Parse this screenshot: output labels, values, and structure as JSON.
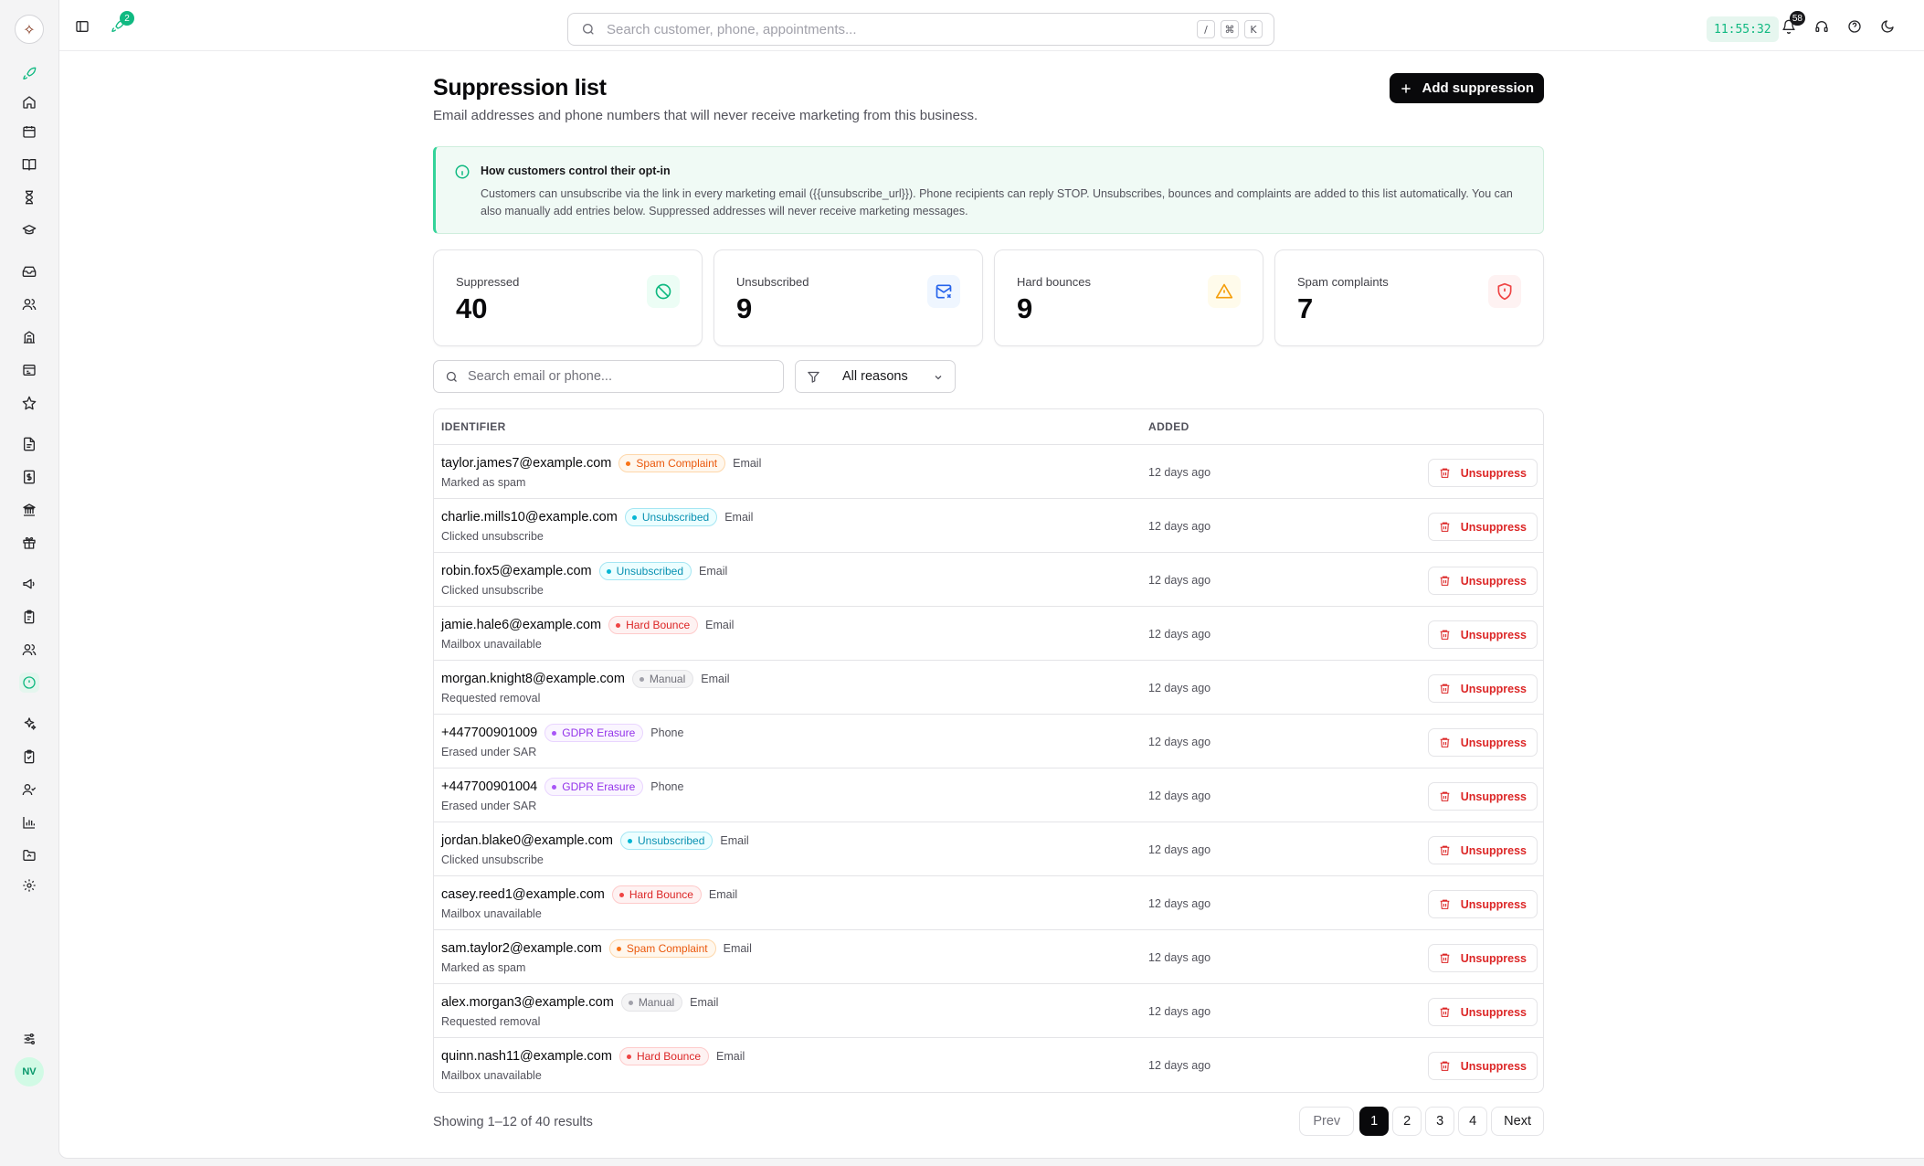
{
  "app": {
    "logo_glyph": "✧"
  },
  "topbar": {
    "rocket_badge": "2",
    "search_placeholder": "Search customer, phone, appointments...",
    "kbd": [
      "/",
      "⌘",
      "K"
    ],
    "clock": "11:55:32",
    "notifications_badge": "58"
  },
  "sidebar": {
    "avatar_initials": "NV",
    "items": [
      "rocket-icon",
      "home-icon",
      "calendar-icon",
      "book-icon",
      "hourglass-icon",
      "graduation-icon",
      "inbox-icon",
      "users-icon",
      "building-icon",
      "receipt-icon",
      "star-icon",
      "document-icon",
      "invoice-icon",
      "bank-icon",
      "gift-icon",
      "megaphone-icon",
      "clipboard-icon",
      "team-icon",
      "suppression-icon",
      "sparkles-icon",
      "checklist-icon",
      "user-check-icon",
      "chart-icon",
      "folder-icon",
      "settings-icon",
      "sliders-icon"
    ]
  },
  "page": {
    "title": "Suppression list",
    "subtitle": "Email addresses and phone numbers that will never receive marketing from this business.",
    "add_button": "Add suppression"
  },
  "info": {
    "title": "How customers control their opt-in",
    "text": "Customers can unsubscribe via the link in every marketing email ({{unsubscribe_url}}). Phone recipients can reply STOP. Unsubscribes, bounces and complaints are added to this list automatically. You can also manually add entries below. Suppressed addresses will never receive marketing messages."
  },
  "stats": [
    {
      "label": "Suppressed",
      "value": "40",
      "icon": "ban-icon",
      "color": "#10b981",
      "bg": "#ecfdf5"
    },
    {
      "label": "Unsubscribed",
      "value": "9",
      "icon": "mail-x-icon",
      "color": "#2563eb",
      "bg": "#eff6ff"
    },
    {
      "label": "Hard bounces",
      "value": "9",
      "icon": "warning-icon",
      "color": "#f59e0b",
      "bg": "#fffbeb"
    },
    {
      "label": "Spam complaints",
      "value": "7",
      "icon": "shield-alert-icon",
      "color": "#ef4444",
      "bg": "#fef2f2"
    }
  ],
  "filters": {
    "search_placeholder": "Search email or phone...",
    "reason_value": "All reasons"
  },
  "table": {
    "headers": {
      "identifier": "IDENTIFIER",
      "added": "ADDED"
    },
    "unsuppress_label": "Unsuppress",
    "rows": [
      {
        "identifier": "taylor.james7@example.com",
        "badge": "Spam Complaint",
        "kind": "spam",
        "channel": "Email",
        "reason": "Marked as spam",
        "added": "12 days ago"
      },
      {
        "identifier": "charlie.mills10@example.com",
        "badge": "Unsubscribed",
        "kind": "unsub",
        "channel": "Email",
        "reason": "Clicked unsubscribe",
        "added": "12 days ago"
      },
      {
        "identifier": "robin.fox5@example.com",
        "badge": "Unsubscribed",
        "kind": "unsub",
        "channel": "Email",
        "reason": "Clicked unsubscribe",
        "added": "12 days ago"
      },
      {
        "identifier": "jamie.hale6@example.com",
        "badge": "Hard Bounce",
        "kind": "hard",
        "channel": "Email",
        "reason": "Mailbox unavailable",
        "added": "12 days ago"
      },
      {
        "identifier": "morgan.knight8@example.com",
        "badge": "Manual",
        "kind": "manual",
        "channel": "Email",
        "reason": "Requested removal",
        "added": "12 days ago"
      },
      {
        "identifier": "+447700901009",
        "badge": "GDPR Erasure",
        "kind": "gdpr",
        "channel": "Phone",
        "reason": "Erased under SAR",
        "added": "12 days ago"
      },
      {
        "identifier": "+447700901004",
        "badge": "GDPR Erasure",
        "kind": "gdpr",
        "channel": "Phone",
        "reason": "Erased under SAR",
        "added": "12 days ago"
      },
      {
        "identifier": "jordan.blake0@example.com",
        "badge": "Unsubscribed",
        "kind": "unsub",
        "channel": "Email",
        "reason": "Clicked unsubscribe",
        "added": "12 days ago"
      },
      {
        "identifier": "casey.reed1@example.com",
        "badge": "Hard Bounce",
        "kind": "hard",
        "channel": "Email",
        "reason": "Mailbox unavailable",
        "added": "12 days ago"
      },
      {
        "identifier": "sam.taylor2@example.com",
        "badge": "Spam Complaint",
        "kind": "spam",
        "channel": "Email",
        "reason": "Marked as spam",
        "added": "12 days ago"
      },
      {
        "identifier": "alex.morgan3@example.com",
        "badge": "Manual",
        "kind": "manual",
        "channel": "Email",
        "reason": "Requested removal",
        "added": "12 days ago"
      },
      {
        "identifier": "quinn.nash11@example.com",
        "badge": "Hard Bounce",
        "kind": "hard",
        "channel": "Email",
        "reason": "Mailbox unavailable",
        "added": "12 days ago"
      }
    ]
  },
  "pagination": {
    "summary": "Showing 1–12 of 40 results",
    "prev": "Prev",
    "pages": [
      "1",
      "2",
      "3",
      "4"
    ],
    "current": "1",
    "next": "Next"
  }
}
